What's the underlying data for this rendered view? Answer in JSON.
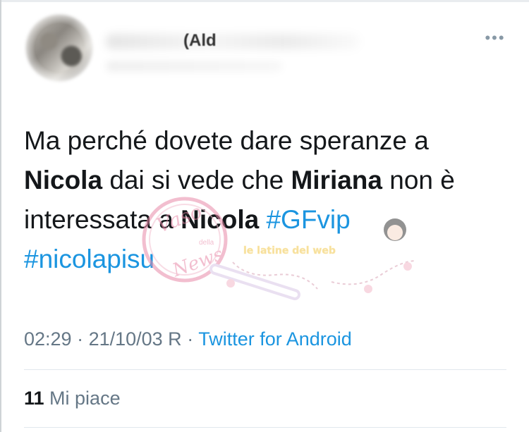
{
  "author": {
    "name_fragment": "(Ald",
    "avatar_icon": "profile-avatar-blurred"
  },
  "more_icon": "more-horizontal-icon",
  "tweet": {
    "part1": "Ma perché dovete dare speranze a ",
    "mention1": "Nicola",
    "part2": " dai si vede che ",
    "mention2": "Miriana",
    "part3": " non è interessata a ",
    "mention3": "Nicola",
    "part4": " ",
    "hashtag1": "#GFvip",
    "part5": " ",
    "hashtag2": "#nicolapisu"
  },
  "meta": {
    "time": "02:29",
    "sep1": " · ",
    "date": "21/10/03 R",
    "sep2": " · ",
    "source": "Twitter for Android"
  },
  "likes": {
    "count": "11",
    "label": " Mi piace"
  },
  "watermark": {
    "text1": "Vaso",
    "text2": "della",
    "text3": "News",
    "text4": "le latine del web"
  },
  "colors": {
    "link": "#1b95e0",
    "secondary": "#657786",
    "primary": "#14171a"
  }
}
